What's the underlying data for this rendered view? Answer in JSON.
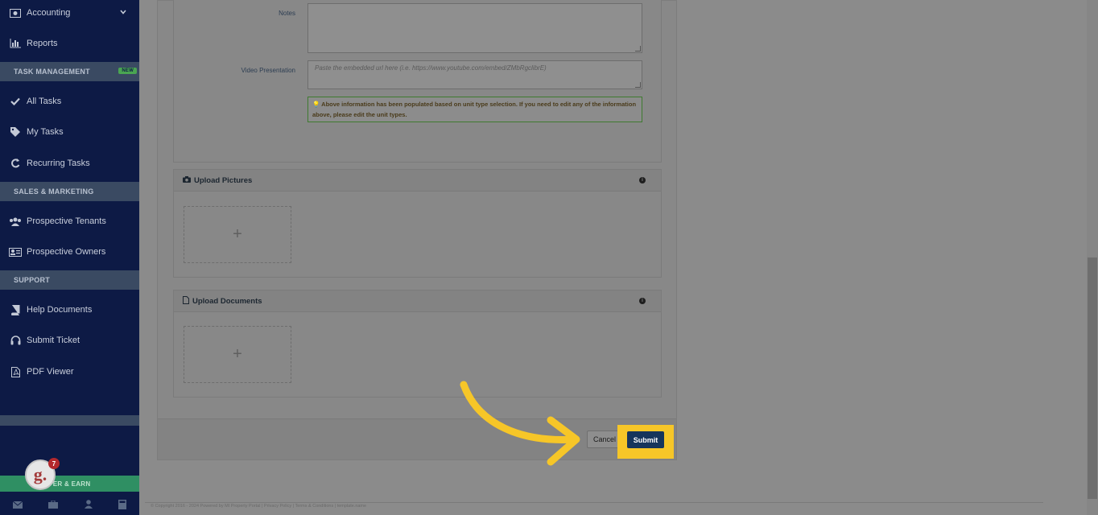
{
  "sidebar": {
    "items": [
      {
        "label": "Accounting",
        "icon": "accounting-icon"
      },
      {
        "label": "Reports",
        "icon": "bar-chart-icon"
      },
      {
        "label": "All Tasks",
        "icon": "check-icon"
      },
      {
        "label": "My Tasks",
        "icon": "tag-icon"
      },
      {
        "label": "Recurring Tasks",
        "icon": "refresh-icon"
      },
      {
        "label": "Prospective Tenants",
        "icon": "users-icon"
      },
      {
        "label": "Prospective Owners",
        "icon": "id-card-icon"
      },
      {
        "label": "Help Documents",
        "icon": "book-icon"
      },
      {
        "label": "Submit Ticket",
        "icon": "headset-icon"
      },
      {
        "label": "PDF Viewer",
        "icon": "pdf-icon"
      }
    ],
    "sections": {
      "task_management": "TASK MANAGEMENT",
      "sales_marketing": "SALES & MARKETING",
      "support": "SUPPORT"
    },
    "new_badge": "NEW",
    "refer_label": "FER & EARN",
    "notification_count": "7",
    "g_logo": "g."
  },
  "form": {
    "notes_label": "Notes",
    "notes_value": "",
    "video_label": "Video Presentation",
    "video_placeholder": "Paste the embedded url here (i.e. https://www.youtube.com/embed/ZMbRgclibrE)",
    "info_text": "Above information has been populated based on unit type selection. If you need to edit any of the information above, please edit the unit types."
  },
  "uploads": {
    "pictures_title": "Upload Pictures",
    "documents_title": "Upload Documents",
    "plus": "+"
  },
  "actions": {
    "cancel": "Cancel",
    "submit": "Submit"
  },
  "footer": {
    "copyright": "© Copyright 2016 - 2024 Powered by MI Property Portal | Privacy Policy | Terms & Conditions | template.name"
  },
  "colors": {
    "sidebar_bg": "#0d1a45",
    "submit_bg": "#16355c",
    "highlight": "#f6c628"
  }
}
